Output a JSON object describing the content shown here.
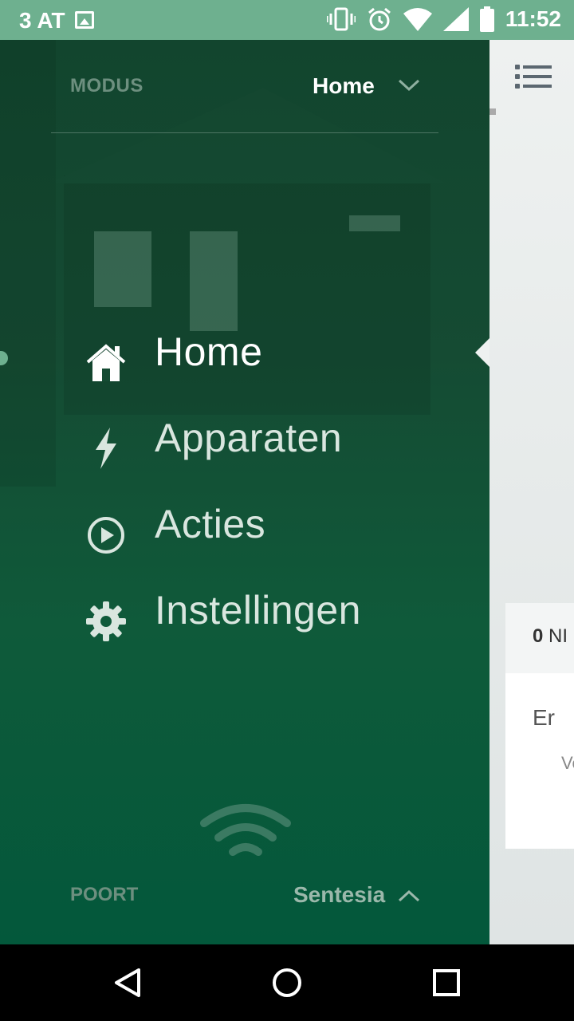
{
  "status_bar": {
    "carrier": "3 AT",
    "time": "11:52",
    "icons": [
      "image-icon",
      "vibrate-icon",
      "alarm-icon",
      "wifi-icon",
      "signal-icon",
      "battery-icon"
    ]
  },
  "drawer": {
    "mode_label": "MODUS",
    "mode_value": "Home",
    "nav_items": [
      {
        "label": "Home",
        "icon": "home-icon",
        "active": true
      },
      {
        "label": "Apparaten",
        "icon": "lightning-icon",
        "active": false
      },
      {
        "label": "Acties",
        "icon": "play-circle-icon",
        "active": false
      },
      {
        "label": "Instellingen",
        "icon": "gear-icon",
        "active": false
      }
    ],
    "port_label": "POORT",
    "port_value": "Sentesia"
  },
  "content": {
    "card_count": "0",
    "card_count_suffix": "NI",
    "card_line1": "Er",
    "card_line2": "Ve"
  },
  "colors": {
    "status_bar": "#6eb08f",
    "drawer_dark": "#12452e",
    "drawer_bottom": "#03583b",
    "content_bg": "#eef1f0"
  }
}
